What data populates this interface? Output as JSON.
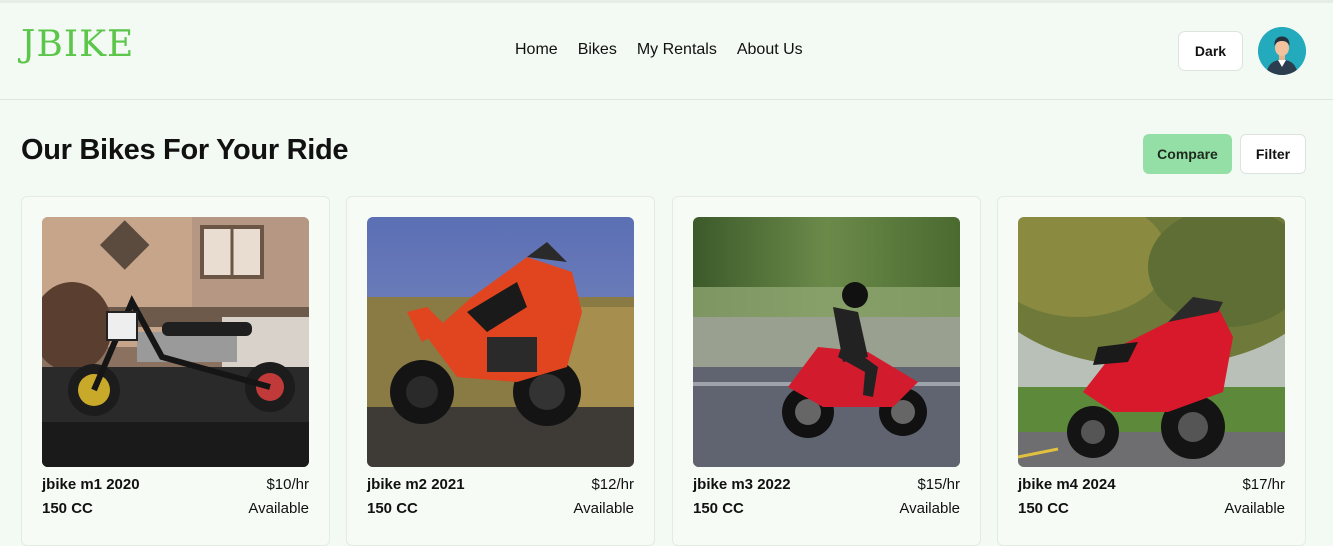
{
  "brand": {
    "logo_text": "JBIKE",
    "accent": "#5bc64a"
  },
  "nav": {
    "items": [
      {
        "label": "Home"
      },
      {
        "label": "Bikes"
      },
      {
        "label": "My Rentals"
      },
      {
        "label": "About Us"
      }
    ]
  },
  "header": {
    "theme_button_label": "Dark",
    "avatar_icon": "user-avatar-icon"
  },
  "page": {
    "title": "Our Bikes For Your Ride",
    "compare_label": "Compare",
    "filter_label": "Filter"
  },
  "bikes": [
    {
      "name": "jbike m1 2020",
      "price": "$10/hr",
      "engine": "150 CC",
      "status": "Available",
      "photo": "mini-bike-photo"
    },
    {
      "name": "jbike m2 2021",
      "price": "$12/hr",
      "engine": "150 CC",
      "status": "Available",
      "photo": "orange-sport-bike-photo"
    },
    {
      "name": "jbike m3 2022",
      "price": "$15/hr",
      "engine": "150 CC",
      "status": "Available",
      "photo": "red-bike-rider-photo"
    },
    {
      "name": "jbike m4 2024",
      "price": "$17/hr",
      "engine": "150 CC",
      "status": "Available",
      "photo": "red-touring-bike-photo"
    }
  ],
  "colors": {
    "background": "#f3f9f3",
    "compare_button": "#93dfa6",
    "avatar_bg": "#23aabc"
  }
}
